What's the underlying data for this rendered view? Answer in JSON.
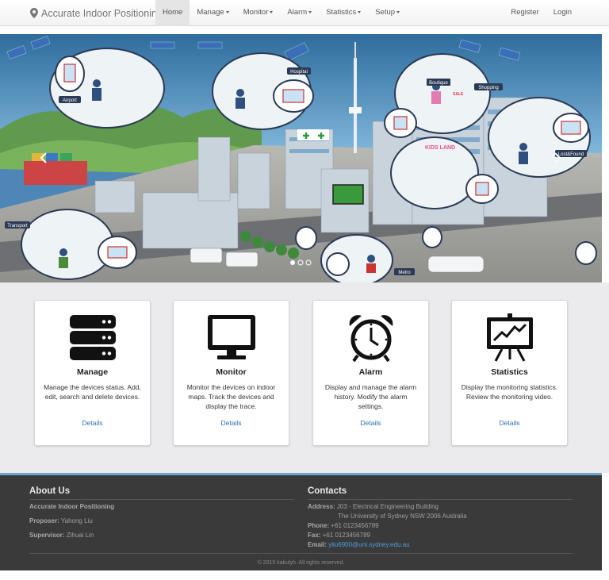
{
  "brand": {
    "title": "Accurate Indoor Positioning",
    "icon": "map-marker-icon"
  },
  "nav": {
    "home": "Home",
    "manage": "Manage",
    "monitor": "Monitor",
    "alarm": "Alarm",
    "statistics": "Statistics",
    "setup": "Setup",
    "register": "Register",
    "login": "Login"
  },
  "hero": {
    "labels": {
      "airport": "Airport",
      "hospital": "Hospital",
      "boutique": "Boutique",
      "shopping": "Shopping",
      "kids_land": "KIDS LAND",
      "lost_found": "Lost&Found",
      "transport": "Transport",
      "metro": "Metro",
      "sale": "SALE"
    }
  },
  "cards": [
    {
      "icon": "server-icon",
      "title": "Manage",
      "text": "Manage the devices status. Add, edit, search and delete devices.",
      "link": "Details"
    },
    {
      "icon": "monitor-icon",
      "title": "Monitor",
      "text": "Monitor the devices on indoor maps. Track the devices and display the trace.",
      "link": "Details"
    },
    {
      "icon": "alarm-clock-icon",
      "title": "Alarm",
      "text": "Display and manage the alarm history. Modify the alarm settings.",
      "link": "Details"
    },
    {
      "icon": "presentation-chart-icon",
      "title": "Statistics",
      "text": "Display the monitoring statistics. Review the monitoring video.",
      "link": "Details"
    }
  ],
  "footer": {
    "about_title": "About Us",
    "project": "Accurate Indoor Positioning",
    "proposer_label": "Proposer:",
    "proposer": "Yahong Liu",
    "supervisor_label": "Supervisor:",
    "supervisor": "Zihuai Lin",
    "contacts_title": "Contacts",
    "address_label": "Address:",
    "address_line1": "J03 - Electrical Engineering Building",
    "address_line2": "The University of Sydney NSW 2006 Australia",
    "phone_label": "Phone:",
    "phone": "+61 0123456789",
    "fax_label": "Fax:",
    "fax": "+61 0123456789",
    "email_label": "Email:",
    "email": "yliu6900@uni.sydney.edu.au",
    "copyright": "© 2015 kakulyh. All rights reserved."
  }
}
